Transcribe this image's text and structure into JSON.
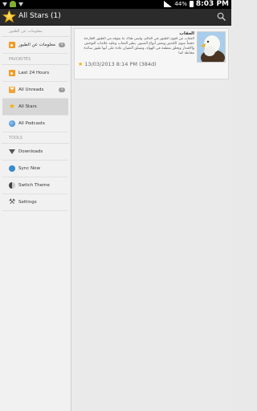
{
  "status_bar": {
    "battery_percent": "44%",
    "time": "8:03 PM"
  },
  "action_bar": {
    "title": "All Stars (1)",
    "icons": [
      "star-logo",
      "search"
    ]
  },
  "sidebar": {
    "feeds_header": "معلومات عن الطيور",
    "feed_items": [
      {
        "label": "معلومات عن الطيور",
        "badge": "1",
        "icon": "rss"
      }
    ],
    "favorites_header": "FAVORITES",
    "favorites": [
      {
        "label": "Last 24 Hours",
        "badge": "",
        "icon": "rss"
      },
      {
        "label": "All Unreads",
        "badge": "1",
        "icon": "mail"
      },
      {
        "label": "All Stars",
        "badge": "",
        "icon": "star"
      },
      {
        "label": "All Podcasts",
        "badge": "",
        "icon": "podcast"
      }
    ],
    "tools_header": "TOOLS",
    "tools": [
      {
        "label": "Downloads",
        "icon": "download"
      },
      {
        "label": "Sync Now",
        "icon": "sync"
      },
      {
        "label": "Switch Theme",
        "icon": "theme"
      },
      {
        "label": "Settings",
        "icon": "settings"
      }
    ]
  },
  "article": {
    "title": "العقاب",
    "body": "العقاب من أقوى الطيور في العالم، وليس هناك ما يفوقه من الطيور الجارحة حجماً سوى الكندور وبعض أنواع النسور. يطير العقاب وعليه علامات التوحش والاقتدار ويحلق بعظمة في الهواء، وتسلق العقبان عادة على أنها طيور سائدة محاطة كما",
    "date": "13/03/2013 8:14 PM (384d)",
    "starred": true
  },
  "colors": {
    "action_bar_bg": "#2b2b2b",
    "sidebar_bg": "#f1f1f1",
    "selected_bg": "#d6d6d6",
    "star_accent": "#f2b300"
  }
}
